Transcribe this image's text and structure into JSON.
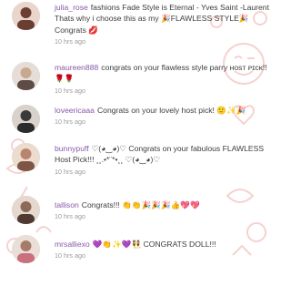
{
  "comments": [
    {
      "username": "julia_rose",
      "text": "fashions Fade Style is Eternal - Yves Saint -Laurent Thats why i choose this as my 🎉FLAWLESS STYLE🎉 Congrats 💋",
      "time": "10 hrs ago",
      "avatar_color": "#6b3e32"
    },
    {
      "username": "maureen888",
      "text": "congrats on your flawless style parry ʜᴏsᴛ ᴘɪᴄᴋ!! 🌹🌹",
      "time": "10 hrs ago",
      "avatar_color": "#c8a98f"
    },
    {
      "username": "loveericaaa",
      "text": "Congrats on your lovely host pick! 🙂✨🎉",
      "time": "10 hrs ago",
      "avatar_color": "#3a3a3a"
    },
    {
      "username": "bunnypuff",
      "text": "♡(◕‿◕)♡ Congrats on your fabulous FLAWLESS Host Pick!!! ¸¸.•*¨*•¸¸ ♡(◕‿◕)♡",
      "time": "10 hrs ago",
      "avatar_color": "#b9856e"
    },
    {
      "username": "tallison",
      "text": "Congrats!!! 👏👏🎉🎉🎉👍💖💖",
      "time": "10 hrs ago",
      "avatar_color": "#8d6a55"
    },
    {
      "username": "mrsalliexo",
      "text": "💜👏✨💜👯 CONGRATS DOLL!!!",
      "time": "10 hrs ago",
      "avatar_color": "#a77b6a"
    }
  ],
  "colors": {
    "username": "#8a5aa8",
    "text": "#3d3d3d",
    "timestamp": "#9a9a9a",
    "decoration": "#f2c4c0"
  }
}
